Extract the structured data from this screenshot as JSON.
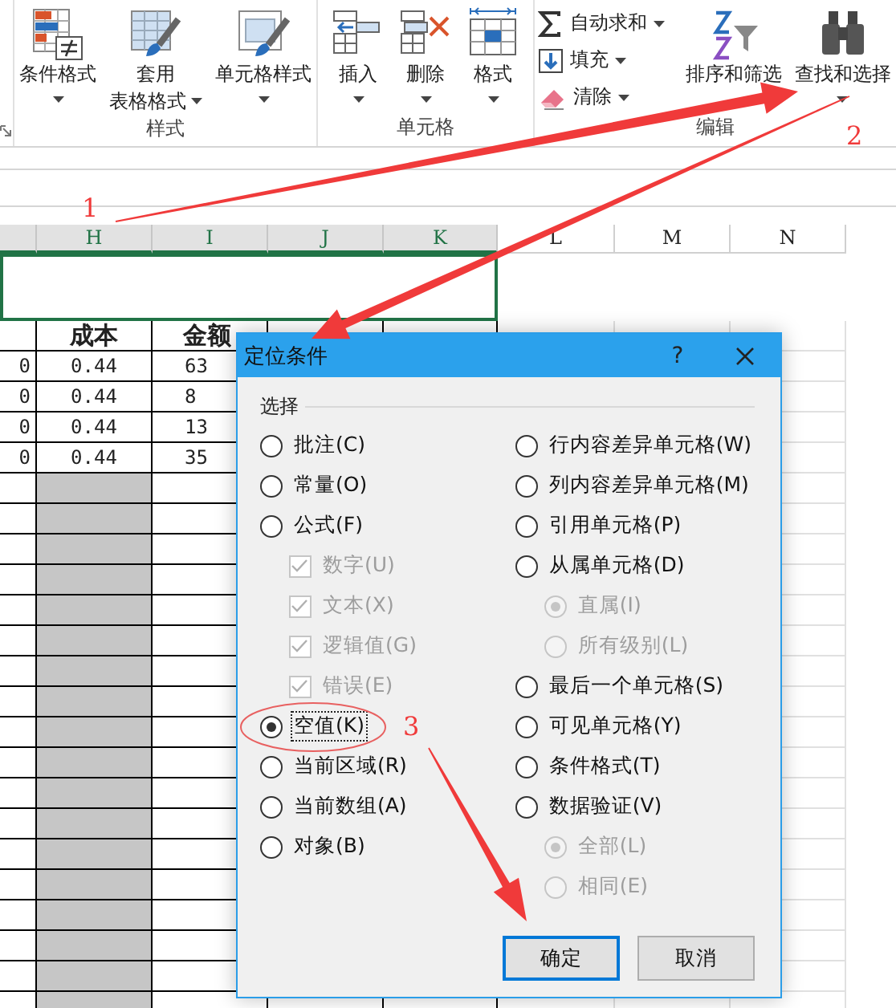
{
  "ribbon": {
    "groups": [
      {
        "label": "样式",
        "buttons": [
          {
            "kind": "large",
            "lines": [
              "条件格式"
            ],
            "dropdown": true
          },
          {
            "kind": "large",
            "lines": [
              "套用",
              "表格格式"
            ],
            "dropdown": true
          },
          {
            "kind": "large",
            "lines": [
              "单元格样式"
            ],
            "dropdown": true
          }
        ]
      },
      {
        "label": "单元格",
        "buttons": [
          {
            "kind": "large",
            "lines": [
              "插入"
            ],
            "dropdown": true
          },
          {
            "kind": "large",
            "lines": [
              "删除"
            ],
            "dropdown": true
          },
          {
            "kind": "large",
            "lines": [
              "格式"
            ],
            "dropdown": true
          }
        ]
      },
      {
        "label": "编辑",
        "buttons": [
          {
            "kind": "small",
            "lines": [
              "自动求和"
            ],
            "dropdown": true
          },
          {
            "kind": "small",
            "lines": [
              "填充"
            ],
            "dropdown": true
          },
          {
            "kind": "small",
            "lines": [
              "清除"
            ],
            "dropdown": true
          },
          {
            "kind": "large",
            "lines": [
              "排序和筛选"
            ],
            "dropdown": false
          },
          {
            "kind": "large",
            "lines": [
              "查找和选择"
            ],
            "dropdown": true
          }
        ]
      }
    ]
  },
  "sheet": {
    "columns": [
      {
        "selected": true
      },
      {
        "label": "H",
        "selected": true
      },
      {
        "label": "I",
        "selected": true
      },
      {
        "label": "J",
        "selected": true
      },
      {
        "label": "K",
        "selected": true
      },
      {
        "label": "L",
        "selected": false
      },
      {
        "label": "M",
        "selected": false
      },
      {
        "label": "N",
        "selected": false
      }
    ],
    "merged_row": {
      "selected": true
    },
    "rows": [
      {
        "kind": "header",
        "cells": [
          "成本",
          "金额"
        ],
        "shaded": false
      },
      {
        "kind": "data",
        "cells": [
          "0",
          "0.44",
          "63"
        ],
        "shaded": false
      },
      {
        "kind": "data",
        "cells": [
          "0",
          "0.44",
          "8"
        ],
        "shaded": false
      },
      {
        "kind": "data",
        "cells": [
          "0",
          "0.44",
          "13"
        ],
        "shaded": false
      },
      {
        "kind": "data",
        "cells": [
          "0",
          "0.44",
          "35"
        ],
        "shaded": false
      },
      {
        "kind": "blank",
        "shaded": true
      },
      {
        "kind": "blank",
        "shaded": true
      },
      {
        "kind": "blank",
        "shaded": true
      },
      {
        "kind": "blank",
        "shaded": true
      },
      {
        "kind": "blank",
        "shaded": true
      },
      {
        "kind": "blank",
        "shaded": true
      },
      {
        "kind": "blank",
        "shaded": true
      },
      {
        "kind": "blank",
        "shaded": true
      },
      {
        "kind": "blank",
        "shaded": true
      },
      {
        "kind": "blank",
        "shaded": true
      },
      {
        "kind": "blank",
        "shaded": true
      },
      {
        "kind": "blank",
        "shaded": true
      },
      {
        "kind": "blank",
        "shaded": true
      },
      {
        "kind": "blank",
        "shaded": true
      },
      {
        "kind": "blank",
        "shaded": true
      },
      {
        "kind": "blank",
        "shaded": true
      },
      {
        "kind": "blank",
        "shaded": true
      },
      {
        "kind": "blank",
        "shaded": true
      }
    ]
  },
  "dialog": {
    "title": "定位条件",
    "help": "?",
    "group_label": "选择",
    "left_options": [
      {
        "kind": "radio",
        "label": "批注(C)",
        "selected": false,
        "disabled": false,
        "focused": false
      },
      {
        "kind": "radio",
        "label": "常量(O)",
        "selected": false,
        "disabled": false,
        "focused": false
      },
      {
        "kind": "radio",
        "label": "公式(F)",
        "selected": false,
        "disabled": false,
        "focused": false,
        "children": [
          {
            "kind": "checkbox",
            "label": "数字(U)",
            "checked": true,
            "disabled": true
          },
          {
            "kind": "checkbox",
            "label": "文本(X)",
            "checked": true,
            "disabled": true
          },
          {
            "kind": "checkbox",
            "label": "逻辑值(G)",
            "checked": true,
            "disabled": true
          },
          {
            "kind": "checkbox",
            "label": "错误(E)",
            "checked": true,
            "disabled": true
          }
        ]
      },
      {
        "kind": "radio",
        "label": "空值(K)",
        "selected": true,
        "disabled": false,
        "focused": true
      },
      {
        "kind": "radio",
        "label": "当前区域(R)",
        "selected": false,
        "disabled": false,
        "focused": false
      },
      {
        "kind": "radio",
        "label": "当前数组(A)",
        "selected": false,
        "disabled": false,
        "focused": false
      },
      {
        "kind": "radio",
        "label": "对象(B)",
        "selected": false,
        "disabled": false,
        "focused": false
      }
    ],
    "right_options": [
      {
        "kind": "radio",
        "label": "行内容差异单元格(W)",
        "selected": false,
        "disabled": false,
        "focused": false
      },
      {
        "kind": "radio",
        "label": "列内容差异单元格(M)",
        "selected": false,
        "disabled": false,
        "focused": false
      },
      {
        "kind": "radio",
        "label": "引用单元格(P)",
        "selected": false,
        "disabled": false,
        "focused": false
      },
      {
        "kind": "radio",
        "label": "从属单元格(D)",
        "selected": false,
        "disabled": false,
        "focused": false,
        "children": [
          {
            "kind": "radio",
            "label": "直属(I)",
            "selected": true,
            "disabled": true
          },
          {
            "kind": "radio",
            "label": "所有级别(L)",
            "selected": false,
            "disabled": true
          }
        ]
      },
      {
        "kind": "radio",
        "label": "最后一个单元格(S)",
        "selected": false,
        "disabled": false,
        "focused": false
      },
      {
        "kind": "radio",
        "label": "可见单元格(Y)",
        "selected": false,
        "disabled": false,
        "focused": false
      },
      {
        "kind": "radio",
        "label": "条件格式(T)",
        "selected": false,
        "disabled": false,
        "focused": false
      },
      {
        "kind": "radio",
        "label": "数据验证(V)",
        "selected": false,
        "disabled": false,
        "focused": false,
        "children": [
          {
            "kind": "radio",
            "label": "全部(L)",
            "selected": true,
            "disabled": true
          },
          {
            "kind": "radio",
            "label": "相同(E)",
            "selected": false,
            "disabled": true
          }
        ]
      }
    ],
    "buttons": [
      {
        "label": "确定",
        "default": true
      },
      {
        "label": "取消",
        "default": false
      }
    ]
  },
  "annotations": [
    {
      "label": "1"
    },
    {
      "label": "2"
    },
    {
      "label": "3"
    }
  ]
}
